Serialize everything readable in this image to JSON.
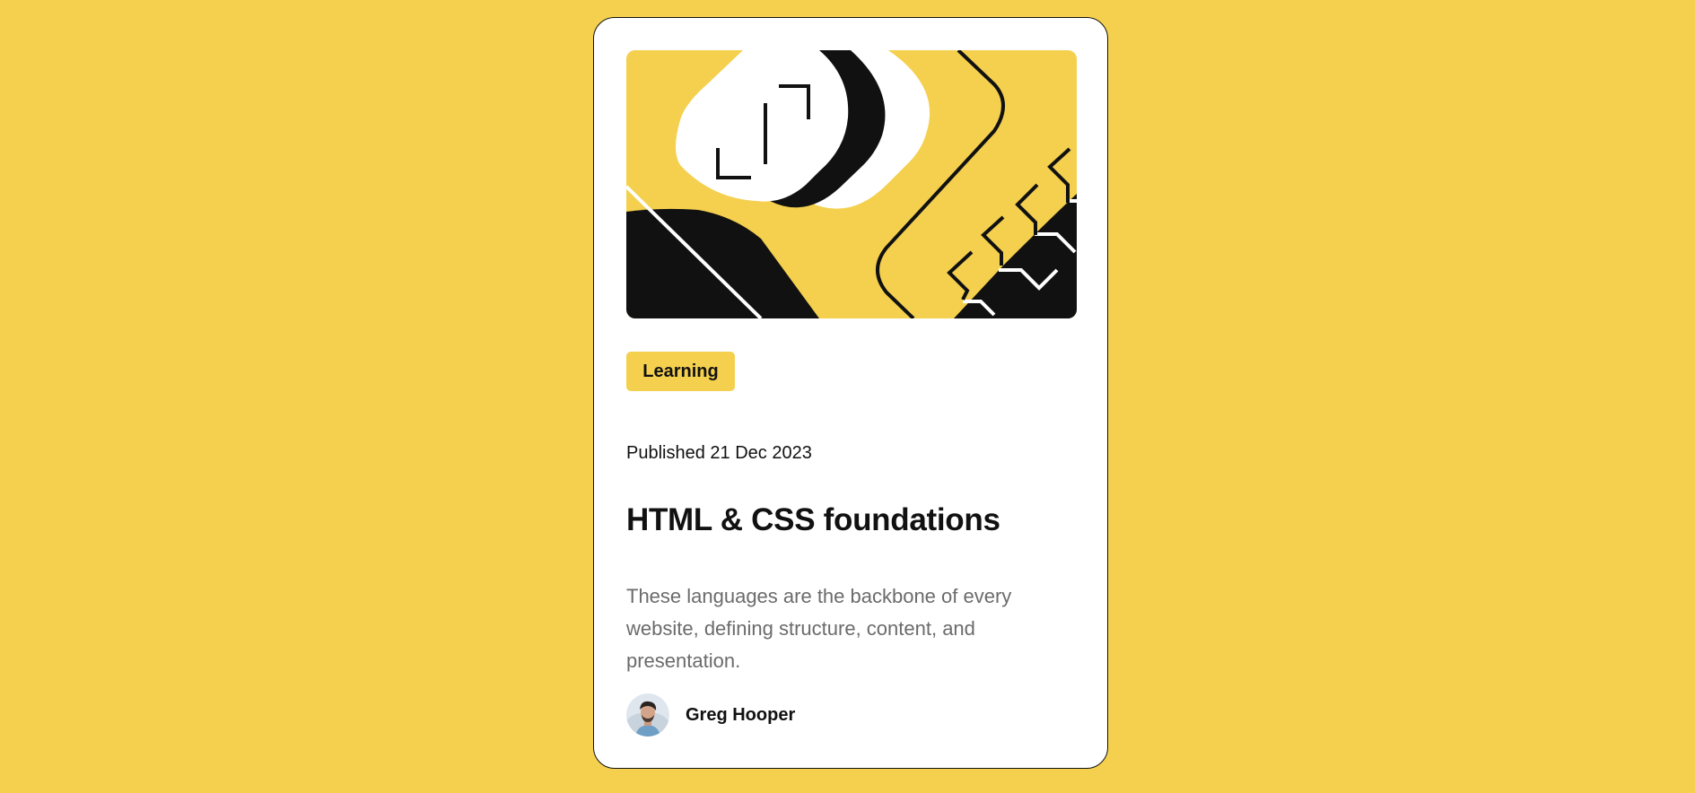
{
  "colors": {
    "background": "#f4d04e",
    "card": "#ffffff",
    "ink": "#111111",
    "muted_text": "#6b6b6b"
  },
  "card": {
    "hero_illustration": "abstract-code-brackets-illustration",
    "tag": "Learning",
    "published": "Published 21 Dec 2023",
    "title": "HTML & CSS foundations",
    "description": "These languages are the backbone of every website, defining structure, content, and presentation.",
    "author": {
      "name": "Greg Hooper",
      "avatar_icon": "author-avatar"
    }
  }
}
